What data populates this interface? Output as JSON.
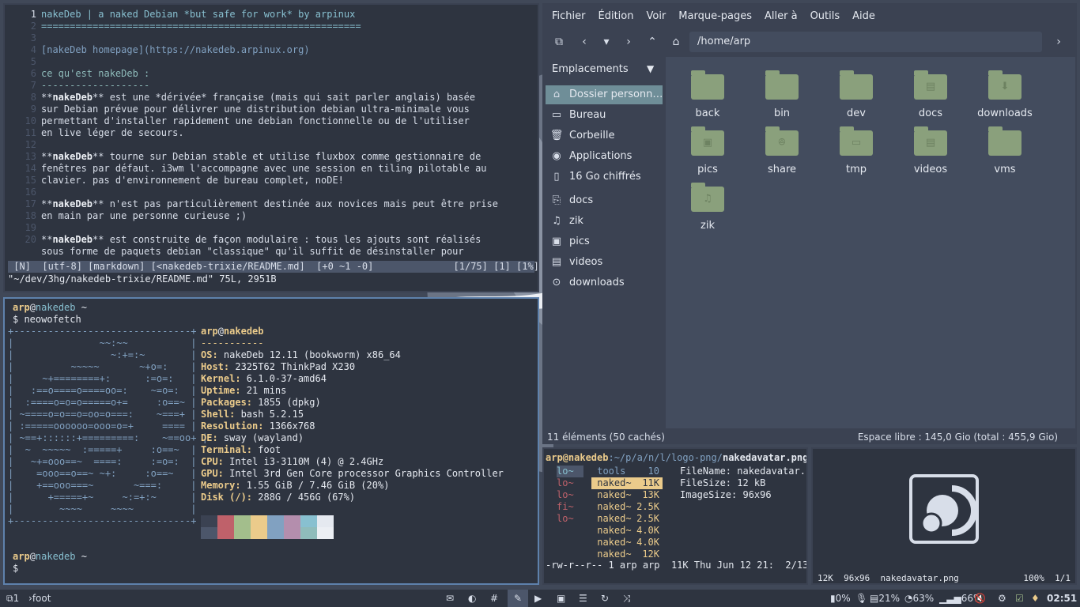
{
  "editor": {
    "lines": [
      {
        "n": "1",
        "html": "<span class=\"h1\">nakeDeb | a naked Debian *but safe for work* by arpinux</span>",
        "cur": true
      },
      {
        "n": "2",
        "html": "<span class=\"h1\">========================================================</span>"
      },
      {
        "n": "3",
        "html": ""
      },
      {
        "n": "4",
        "html": "<span class=\"lnk\">[nakeDeb homepage](https://nakedeb.arpinux.org)</span>"
      },
      {
        "n": "5",
        "html": ""
      },
      {
        "n": "6",
        "html": "<span class=\"dim\">ce qu'est nakeDeb :</span>"
      },
      {
        "n": "7",
        "html": "<span class=\"dim\">-------------------</span>"
      },
      {
        "n": "8",
        "html": "**<span class=\"b\">nakeDeb</span>** est une *dérivée* française (mais qui sait parler anglais) basée"
      },
      {
        "n": "9",
        "html": "sur Debian prévue pour délivrer une distribution debian ultra-minimale vous"
      },
      {
        "n": "10",
        "html": "permettant d'installer rapidement une debian fonctionnelle ou de l'utiliser"
      },
      {
        "n": "11",
        "html": "en live léger de secours."
      },
      {
        "n": "12",
        "html": ""
      },
      {
        "n": "13",
        "html": "**<span class=\"b\">nakeDeb</span>** tourne sur Debian stable et utilise fluxbox comme gestionnaire de"
      },
      {
        "n": "14",
        "html": "fenêtres par défaut. i3wm l'accompagne avec une session en tiling pilotable au"
      },
      {
        "n": "15",
        "html": "clavier. pas d'environnement de bureau complet, noDE!"
      },
      {
        "n": "16",
        "html": ""
      },
      {
        "n": "17",
        "html": "**<span class=\"b\">nakeDeb</span>** n'est pas particulièrement destinée aux novices mais peut être prise"
      },
      {
        "n": "18",
        "html": "en main par une personne curieuse ;)"
      },
      {
        "n": "19",
        "html": ""
      },
      {
        "n": "20",
        "html": "**<span class=\"b\">nakeDeb</span>** est construite de façon modulaire : tous les ajouts sont réalisés"
      },
      {
        "n": "",
        "html": "sous forme de paquets debian \"classique\" qu'il suffit de désinstaller pour"
      }
    ],
    "status": " [N]  [utf-8] [markdown] [<nakedeb-trixie/README.md]  [+0 ~1 -0]              [1/75] [1] [1%]",
    "cmdline": "\"~/dev/3hg/nakedeb-trixie/README.md\" 75L, 2951B"
  },
  "terminal": {
    "prompt_user": "arp",
    "prompt_host": "nakedeb",
    "prompt_dir": " ~",
    "command": "$ neowofetch",
    "final_prompt": "$",
    "logo": [
      "+-------------------------------+",
      "|               ~~:~~           |",
      "|                 ~:+=:~        |",
      "|          ~~~~~       ~+o=:    |",
      "|     ~+========+:      :=o=:   |",
      "|   :==o====o====oo=:    ~=o=:  |",
      "|  :====o=o=o=====o+=     :o==~ |",
      "| ~====o=o==o=oo=o===:    ~===+ |",
      "| :=====oooooo=ooo=o=+     ==== |",
      "| ~==+::::::+=========:    ~==oo+ |",
      "|  ~  ~~~~~  :=====+     :o==~  |",
      "|   ~+=ooo==~  ====:     :=o=:  |",
      "|    =ooo==o==~ ~+:     :o==~   |",
      "|    +==ooo===~       ~===:     |",
      "|      +=====+~     ~:=+:~      |",
      "|        ~~~~     ~~~~          |",
      "+-------------------------------+"
    ],
    "info_user": "arp",
    "info_host": "nakedeb",
    "separator": "-----------",
    "info": [
      {
        "k": "OS",
        "v": "nakeDeb 12.11 (bookworm) x86_64"
      },
      {
        "k": "Host",
        "v": "2325T62 ThinkPad X230"
      },
      {
        "k": "Kernel",
        "v": "6.1.0-37-amd64"
      },
      {
        "k": "Uptime",
        "v": "21 mins"
      },
      {
        "k": "Packages",
        "v": "1855 (dpkg)"
      },
      {
        "k": "Shell",
        "v": "bash 5.2.15"
      },
      {
        "k": "Resolution",
        "v": "1366x768"
      },
      {
        "k": "DE",
        "v": "sway (wayland)"
      },
      {
        "k": "Terminal",
        "v": "foot"
      },
      {
        "k": "CPU",
        "v": "Intel i3-3110M (4) @ 2.4GHz"
      },
      {
        "k": "GPU",
        "v": "Intel 3rd Gen Core processor Graphics Controller"
      },
      {
        "k": "Memory",
        "v": "1.55 GiB / 7.46 GiB (20%)"
      },
      {
        "k": "Disk (/)",
        "v": "288G / 456G (67%)"
      }
    ],
    "palette_top": [
      "#3b4252",
      "#bf616a",
      "#a3be8c",
      "#ebcb8b",
      "#81a1c1",
      "#b48ead",
      "#88c0d0",
      "#e5e9f0"
    ],
    "palette_bottom": [
      "#4c566a",
      "#bf616a",
      "#a3be8c",
      "#ebcb8b",
      "#81a1c1",
      "#b48ead",
      "#8fbcbb",
      "#eceff4"
    ]
  },
  "filemanager": {
    "menu": [
      "Fichier",
      "Édition",
      "Voir",
      "Marque-pages",
      "Aller à",
      "Outils",
      "Aide"
    ],
    "path": "/home/arp",
    "places_title": "Emplacements",
    "places": [
      {
        "label": "Dossier personn…",
        "icon": "⌂",
        "name": "home-icon",
        "sel": true
      },
      {
        "label": "Bureau",
        "icon": "▭",
        "name": "desktop-icon"
      },
      {
        "label": "Corbeille",
        "icon": "🗑",
        "name": "trash-icon"
      },
      {
        "label": "Applications",
        "icon": "◉",
        "name": "applications-icon"
      },
      {
        "label": "16 Go chiffrés",
        "icon": "▯",
        "name": "encrypted-drive-icon"
      },
      {
        "label": "docs",
        "icon": "⎘",
        "name": "docs-bookmark-icon"
      },
      {
        "label": "zik",
        "icon": "♫",
        "name": "music-bookmark-icon"
      },
      {
        "label": "pics",
        "icon": "▣",
        "name": "pictures-bookmark-icon"
      },
      {
        "label": "videos",
        "icon": "▤",
        "name": "videos-bookmark-icon"
      },
      {
        "label": "downloads",
        "icon": "⊙",
        "name": "downloads-bookmark-icon"
      }
    ],
    "folders": [
      {
        "label": "back",
        "glyph": ""
      },
      {
        "label": "bin",
        "glyph": ""
      },
      {
        "label": "dev",
        "glyph": ""
      },
      {
        "label": "docs",
        "glyph": "▤"
      },
      {
        "label": "downloads",
        "glyph": "⬇"
      },
      {
        "label": "pics",
        "glyph": "▣"
      },
      {
        "label": "share",
        "glyph": "ꔮ"
      },
      {
        "label": "tmp",
        "glyph": "▭"
      },
      {
        "label": "videos",
        "glyph": "▤"
      },
      {
        "label": "vms",
        "glyph": ""
      },
      {
        "label": "zik",
        "glyph": "♫"
      }
    ],
    "status_left": "11 éléments (50 cachés)",
    "status_right": "Espace libre : 145,0 Gio (total : 455,9 Gio)"
  },
  "lf": {
    "header_user": "arp@nakedeb",
    "header_path": ":~/p/a/n/l/logo-png/",
    "header_file": "nakedavatar.png",
    "col1": [
      "lo~",
      "lo~",
      "lo~",
      "fi~",
      "lo~"
    ],
    "col2": [
      {
        "n": "tools",
        "s": "10"
      },
      {
        "n": "naked~",
        "s": "11K",
        "sel": true
      },
      {
        "n": "naked~",
        "s": "13K"
      },
      {
        "n": "naked~",
        "s": "2.5K"
      },
      {
        "n": "naked~",
        "s": "2.5K"
      },
      {
        "n": "naked~",
        "s": "4.0K"
      },
      {
        "n": "naked~",
        "s": "4.0K"
      },
      {
        "n": "naked~",
        "s": "12K"
      }
    ],
    "info": [
      "FileName: nakedavatar.",
      "FileSize: 12 kB",
      "ImageSize: 96x96"
    ],
    "footer": "-rw-r--r-- 1 arp arp  11K Thu Jun 12 21:  2/13"
  },
  "preview": {
    "footer_left": "12K  96x96  nakedavatar.png",
    "footer_right": "100%  1/1"
  },
  "bar": {
    "workspace": "1",
    "window_title": "foot",
    "cpu": "0%",
    "disk": "21%",
    "battery": "63%",
    "brightness": "66%",
    "clock": "02:51"
  }
}
